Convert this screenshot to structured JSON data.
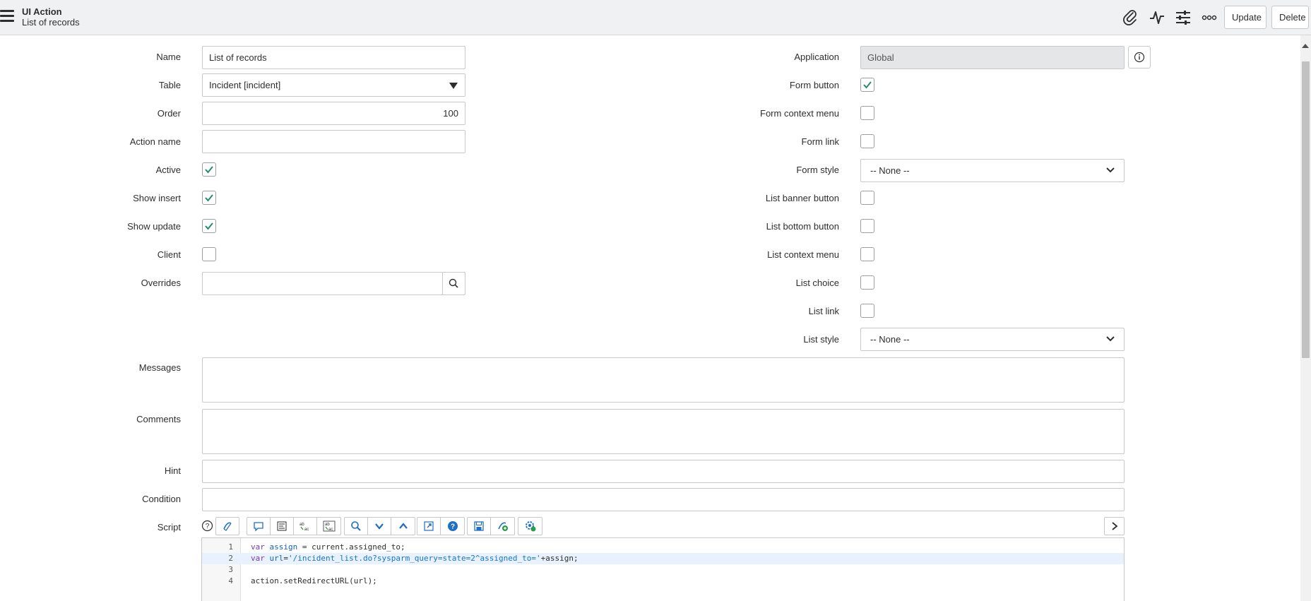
{
  "header": {
    "record_type": "UI Action",
    "record_name": "List of records",
    "update_label": "Update",
    "delete_label": "Delete",
    "icons": [
      "menu-icon",
      "paperclip-icon",
      "activity-icon",
      "settings-sliders-icon",
      "more-icon"
    ]
  },
  "left": {
    "name_label": "Name",
    "name_value": "List of records",
    "table_label": "Table",
    "table_value": "Incident [incident]",
    "order_label": "Order",
    "order_value": "100",
    "action_name_label": "Action name",
    "action_name_value": "",
    "active_label": "Active",
    "active_checked": true,
    "show_insert_label": "Show insert",
    "show_insert_checked": true,
    "show_update_label": "Show update",
    "show_update_checked": true,
    "client_label": "Client",
    "client_checked": false,
    "overrides_label": "Overrides",
    "overrides_value": ""
  },
  "right": {
    "application_label": "Application",
    "application_value": "Global",
    "form_button_label": "Form button",
    "form_button_checked": true,
    "form_context_menu_label": "Form context menu",
    "form_link_label": "Form link",
    "form_style_label": "Form style",
    "form_style_value": "-- None --",
    "list_banner_button_label": "List banner button",
    "list_bottom_button_label": "List bottom button",
    "list_context_menu_label": "List context menu",
    "list_choice_label": "List choice",
    "list_link_label": "List link",
    "list_style_label": "List style",
    "list_style_value": "-- None --"
  },
  "wide": {
    "messages_label": "Messages",
    "comments_label": "Comments",
    "hint_label": "Hint",
    "condition_label": "Condition",
    "script_label": "Script"
  },
  "script": {
    "lines": [
      {
        "num": "1",
        "parts": [
          {
            "t": "var",
            "c": "kw"
          },
          {
            "t": " ",
            "c": ""
          },
          {
            "t": "assign",
            "c": "var"
          },
          {
            "t": " = current.assigned_to;",
            "c": ""
          }
        ]
      },
      {
        "num": "2",
        "parts": [
          {
            "t": "var",
            "c": "kw"
          },
          {
            "t": " ",
            "c": ""
          },
          {
            "t": "url",
            "c": "var"
          },
          {
            "t": "=",
            "c": ""
          },
          {
            "t": "'/incident_list.do?sysparm_query=state=2^assigned_to='",
            "c": "str"
          },
          {
            "t": "+assign;",
            "c": ""
          }
        ]
      },
      {
        "num": "3",
        "parts": []
      },
      {
        "num": "4",
        "parts": [
          {
            "t": "action.setRedirectURL(url);",
            "c": ""
          }
        ]
      }
    ]
  },
  "colors": {
    "check": "#278a6d",
    "header_bg": "#f0f1f2",
    "border": "#c7c8ca"
  }
}
